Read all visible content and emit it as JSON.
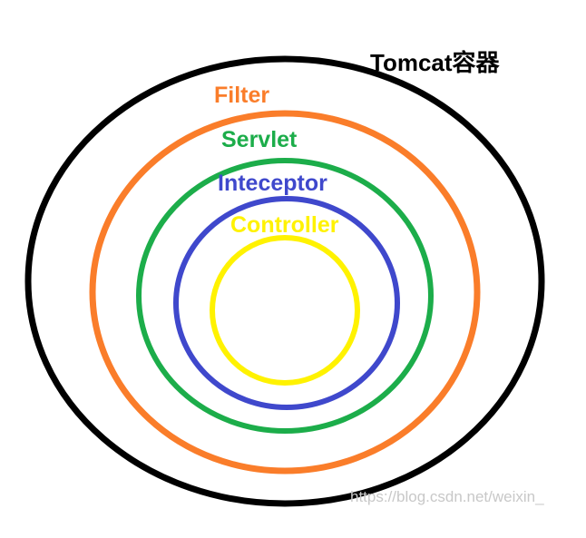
{
  "layers": [
    {
      "id": "tomcat",
      "label": "Tomcat容器",
      "color": "#000000"
    },
    {
      "id": "filter",
      "label": "Filter",
      "color": "#fa7d2a"
    },
    {
      "id": "servlet",
      "label": "Servlet",
      "color": "#1cad4a"
    },
    {
      "id": "interceptor",
      "label": "Inteceptor",
      "color": "#3f48cc"
    },
    {
      "id": "controller",
      "label": "Controller",
      "color": "#fff200"
    }
  ],
  "watermark": "https://blog.csdn.net/weixin_"
}
